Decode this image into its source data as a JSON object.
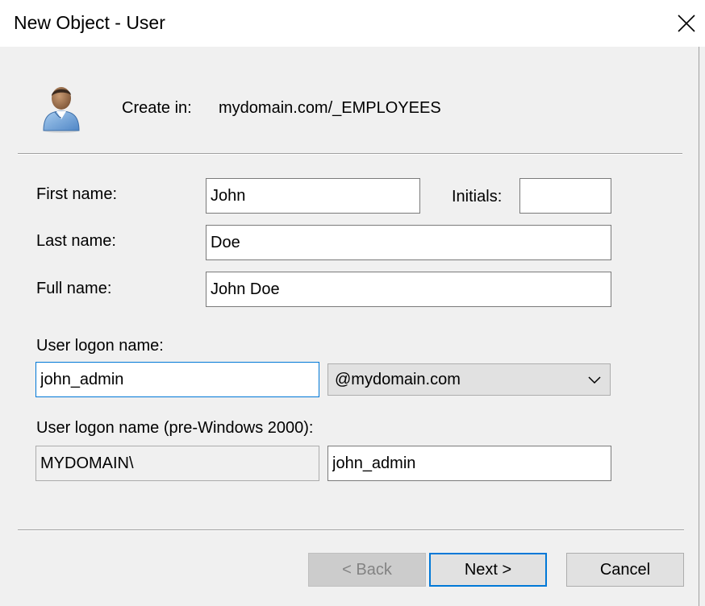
{
  "window": {
    "title": "New Object - User",
    "close_icon": "close-icon"
  },
  "header": {
    "icon": "user-icon",
    "create_in_label": "Create in:",
    "create_in_path": "mydomain.com/_EMPLOYEES"
  },
  "form": {
    "first_name_label": "First name:",
    "first_name_value": "John",
    "initials_label": "Initials:",
    "initials_value": "",
    "last_name_label": "Last name:",
    "last_name_value": "Doe",
    "full_name_label": "Full name:",
    "full_name_value": "John Doe",
    "logon_name_label": "User logon name:",
    "logon_name_value": "john_admin",
    "domain_suffix": "@mydomain.com",
    "pre2000_label": "User logon name (pre-Windows 2000):",
    "pre2000_domain": "MYDOMAIN\\",
    "pre2000_value": "john_admin"
  },
  "buttons": {
    "back": "< Back",
    "next": "Next >",
    "cancel": "Cancel"
  },
  "colors": {
    "focus_border": "#0078d7",
    "dialog_background": "#f0f0f0"
  }
}
